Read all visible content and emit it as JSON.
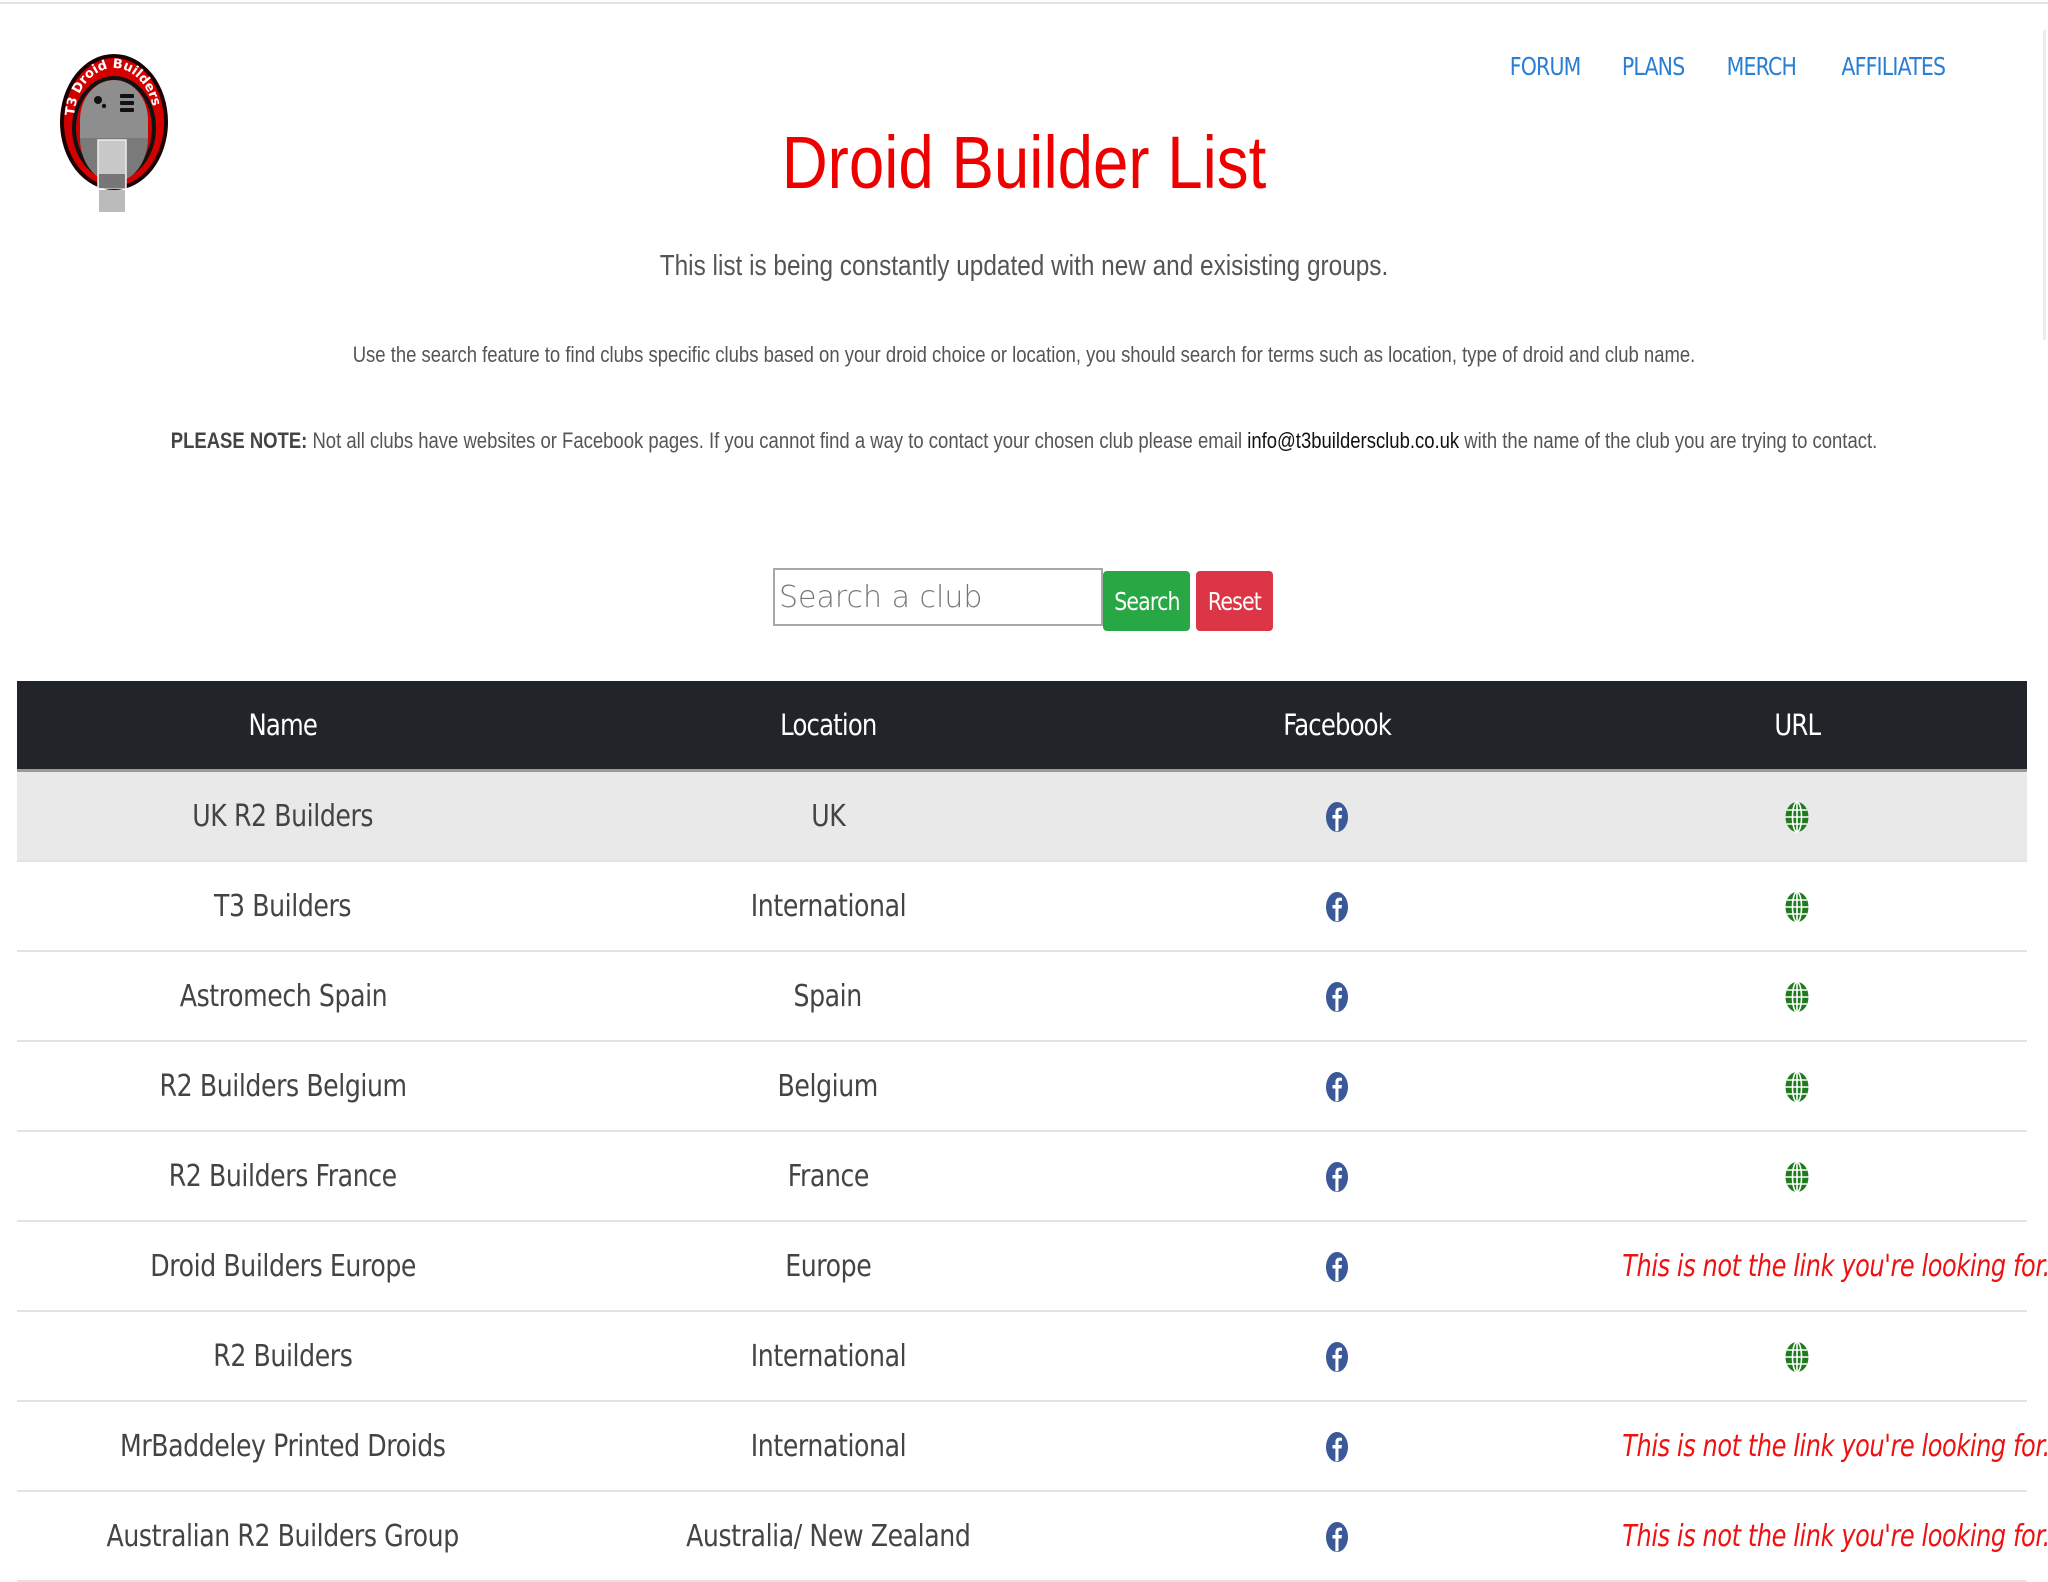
{
  "header": {
    "logo_text": "T3 Droid Builders",
    "nav": [
      {
        "label": "FORUM"
      },
      {
        "label": "PLANS"
      },
      {
        "label": "MERCH"
      },
      {
        "label": "AFFILIATES"
      }
    ]
  },
  "page": {
    "title": "Droid Builder List",
    "subtitle": "This list is being constantly updated with new and exisisting groups.",
    "instructions": "Use the search feature to find clubs specific clubs based on your droid choice or location, you should search for terms such as location, type of droid and club name.",
    "note_label": "PLEASE NOTE:",
    "note_text_before": " Not all clubs have websites or Facebook pages. If you cannot find a way to contact your chosen club please email ",
    "note_email": "info@t3buildersclub.co.uk",
    "note_text_after": " with the name of the club you are trying to contact."
  },
  "search": {
    "placeholder": "Search a club",
    "value": "",
    "search_label": "Search",
    "reset_label": "Reset"
  },
  "colors": {
    "title_red": "#ee0000",
    "nav_blue": "#2a7fd4",
    "search_green": "#28a745",
    "reset_red": "#dc3545",
    "table_header": "#212529",
    "facebook_blue": "#3b5998",
    "globe_green": "#1e7b1e"
  },
  "table": {
    "columns": [
      "Name",
      "Location",
      "Facebook",
      "URL"
    ],
    "no_link_text": "This is not the link you're looking for...",
    "rows": [
      {
        "name": "UK R2 Builders",
        "location": "UK",
        "facebook": "facebook-icon",
        "url": "globe-icon"
      },
      {
        "name": "T3 Builders",
        "location": "International",
        "facebook": "facebook-icon",
        "url": "globe-icon"
      },
      {
        "name": "Astromech Spain",
        "location": "Spain",
        "facebook": "facebook-icon",
        "url": "globe-icon"
      },
      {
        "name": "R2 Builders Belgium",
        "location": "Belgium",
        "facebook": "facebook-icon",
        "url": "globe-icon"
      },
      {
        "name": "R2 Builders France",
        "location": "France",
        "facebook": "facebook-icon",
        "url": "globe-icon"
      },
      {
        "name": "Droid Builders Europe",
        "location": "Europe",
        "facebook": "facebook-icon",
        "url": "none"
      },
      {
        "name": "R2 Builders",
        "location": "International",
        "facebook": "facebook-icon",
        "url": "globe-icon"
      },
      {
        "name": "MrBaddeley Printed Droids",
        "location": "International",
        "facebook": "facebook-icon",
        "url": "none"
      },
      {
        "name": "Australian R2 Builders Group",
        "location": "Australia/ New Zealand",
        "facebook": "facebook-icon",
        "url": "none"
      }
    ]
  }
}
